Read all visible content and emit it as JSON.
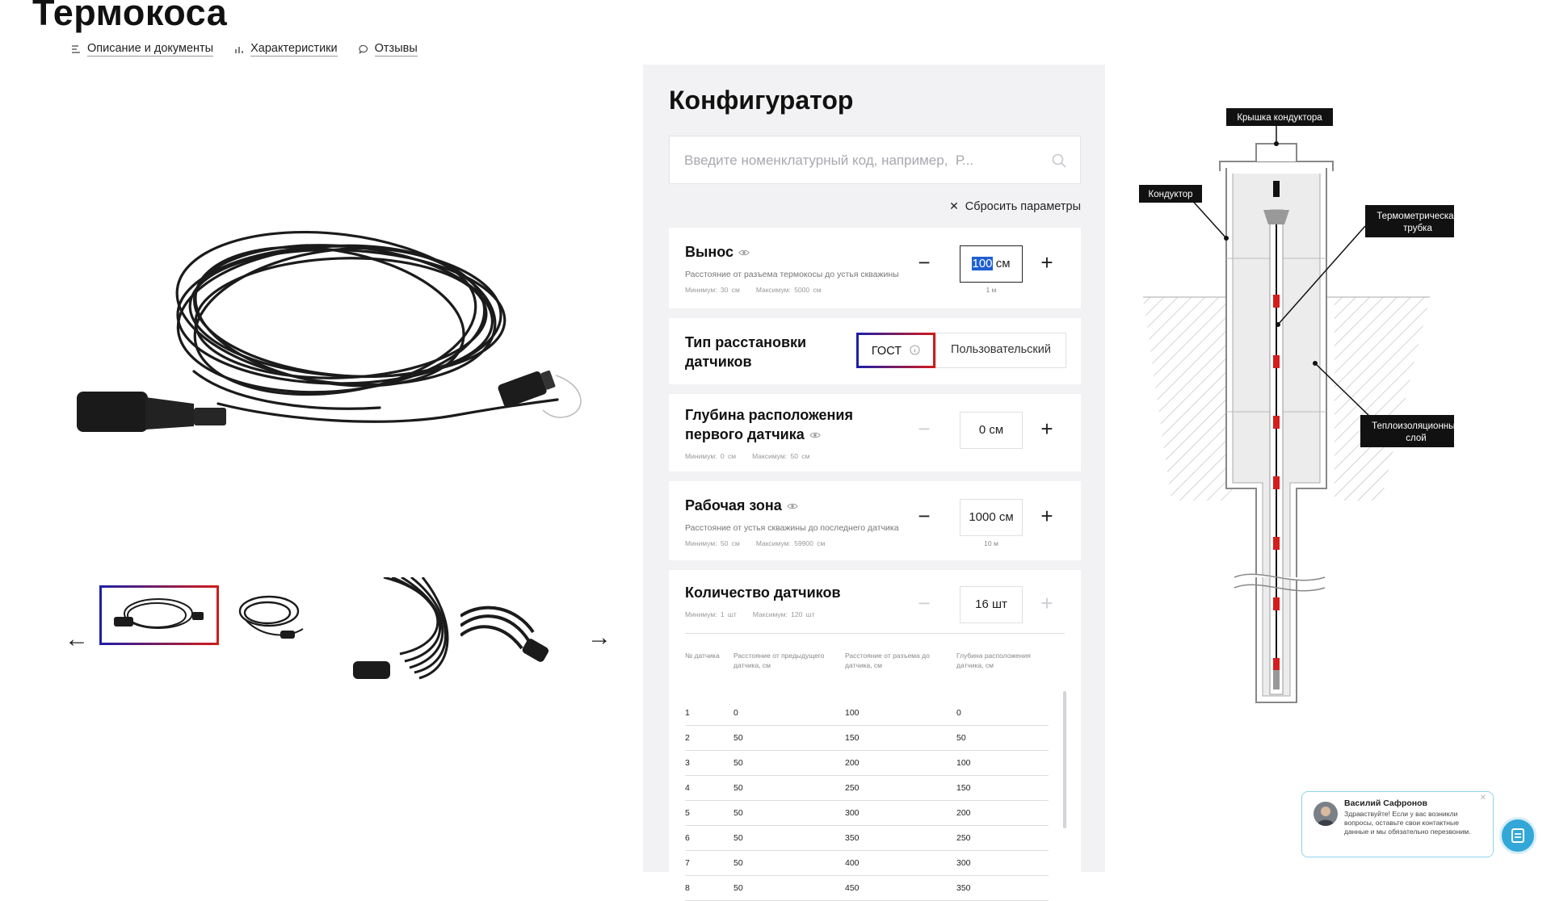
{
  "page": {
    "title": "Термокоса",
    "tabs": [
      {
        "label": "Описание и документы",
        "icon": "list-icon"
      },
      {
        "label": "Характеристики",
        "icon": "bars-icon"
      },
      {
        "label": "Отзывы",
        "icon": "comment-icon"
      }
    ]
  },
  "gallery": {
    "prev_icon": "arrow-left-icon",
    "next_icon": "arrow-right-icon",
    "thumbnail_count": 4,
    "selected_index": 0
  },
  "configurator": {
    "title": "Конфигуратор",
    "search_placeholder": "Введите номенклатурный код, например,  Р...",
    "reset_label": "Сбросить параметры",
    "vynos": {
      "name": "Вынос",
      "desc": "Расстояние от разъема термокосы до устья скважины",
      "min": "Минимум: 30 см",
      "max": "Максимум: 5000 см",
      "value_selected": "100",
      "unit": "см",
      "sub": "1 м"
    },
    "placement": {
      "name_l1": "Тип расстановки",
      "name_l2": "датчиков",
      "option_gost": "ГОСТ",
      "option_custom": "Пользовательский",
      "selected": "ГОСТ"
    },
    "first_depth": {
      "name_l1": "Глубина расположения",
      "name_l2": "первого датчика",
      "min": "Минимум: 0 см",
      "max": "Максимум: 50 см",
      "value": "0 см"
    },
    "work_zone": {
      "name": "Рабочая зона",
      "desc": "Расстояние от устья скважины до последнего датчика",
      "min": "Минимум: 50 см",
      "max": "Максимум: 59900 см",
      "value": "1000 см",
      "sub": "10 м"
    },
    "sensor_count": {
      "name": "Количество датчиков",
      "min": "Минимум: 1 шт",
      "max": "Максимум: 120 шт",
      "value": "16 шт"
    },
    "table": {
      "headers": [
        "№ датчика",
        "Расстояние от предыдущего датчика, см",
        "Расстояние от разъема до датчика, см",
        "Глубина расположения датчика, см"
      ],
      "rows": [
        [
          "1",
          "0",
          "100",
          "0"
        ],
        [
          "2",
          "50",
          "150",
          "50"
        ],
        [
          "3",
          "50",
          "200",
          "100"
        ],
        [
          "4",
          "50",
          "250",
          "150"
        ],
        [
          "5",
          "50",
          "300",
          "200"
        ],
        [
          "6",
          "50",
          "350",
          "250"
        ],
        [
          "7",
          "50",
          "400",
          "300"
        ],
        [
          "8",
          "50",
          "450",
          "350"
        ]
      ]
    }
  },
  "diagram": {
    "labels": {
      "cap": "Крышка кондуктора",
      "conductor": "Кондуктор",
      "tube_l1": "Термометрическая",
      "tube_l2": "трубка",
      "insul_l1": "Теплоизоляционный",
      "insul_l2": "слой"
    }
  },
  "chat": {
    "name": "Василий Сафронов",
    "message": "Здравствуйте! Если у вас возникли вопросы, оставьте свои контактные данные и мы обязательно перезвоним.",
    "close_icon": "close-icon",
    "button_icon": "chat-icon"
  },
  "colors": {
    "accent_blue": "#1e1ea8",
    "accent_red": "#d21b1b",
    "sensor_red": "#d41e1e",
    "chat_blue": "#33a8d8"
  }
}
